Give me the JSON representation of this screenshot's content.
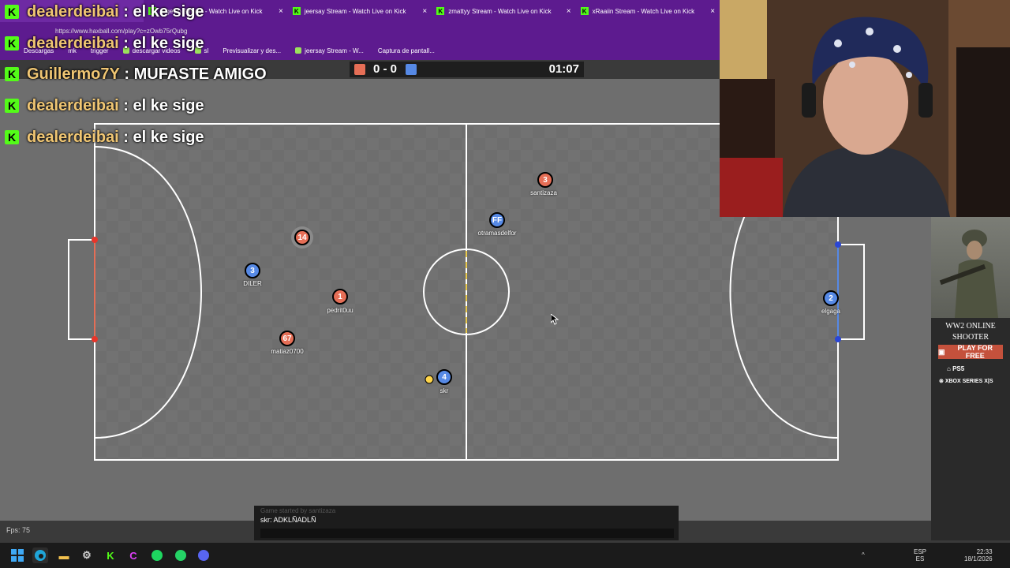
{
  "browser": {
    "tabs": [
      {
        "title": "",
        "active": true
      },
      {
        "title": "rageylo Stream - Watch Live on Kick"
      },
      {
        "title": "jeersay Stream - Watch Live on Kick"
      },
      {
        "title": "zmattyy Stream - Watch Live on Kick"
      },
      {
        "title": "xRaaiin Stream - Watch Live on Kick"
      }
    ],
    "url": "https://www.haxball.com/play?c=zOwb75rQubg",
    "bookmarks": [
      "Descargas",
      "mk",
      "trigger",
      "descargar videos",
      "sl",
      "Previsualizar y des...",
      "jeersay Stream - W...",
      "Captura de pantall..."
    ]
  },
  "chat_overlay": [
    {
      "user": "dealerdeibai",
      "message": "el ke sige"
    },
    {
      "user": "dealerdeibai",
      "message": "el ke sige"
    },
    {
      "user": "Guillermo7Y",
      "message": "MUFASTE AMIGO"
    },
    {
      "user": "dealerdeibai",
      "message": "el ke sige"
    },
    {
      "user": "dealerdeibai",
      "message": "el ke sige"
    }
  ],
  "game": {
    "score": "0 - 0",
    "time": "01:07",
    "colors": {
      "red": "#e56e56",
      "blue": "#5689e5",
      "ball": "#ffd54a"
    },
    "players": [
      {
        "team": "red",
        "number": "3",
        "name": "santizaza"
      },
      {
        "team": "blue",
        "number": "FF",
        "name": "otramasdelfor"
      },
      {
        "team": "red",
        "number": "14",
        "name": ""
      },
      {
        "team": "blue",
        "number": "3",
        "name": "DILER"
      },
      {
        "team": "red",
        "number": "1",
        "name": "pedrit0uu"
      },
      {
        "team": "red",
        "number": "67",
        "name": "matiaz0700"
      },
      {
        "team": "blue",
        "number": "4",
        "name": "skr"
      },
      {
        "team": "blue",
        "number": "2",
        "name": "elgaga"
      }
    ],
    "fps": "Fps: 75",
    "chat": {
      "faded_line": "Game started by santizaza",
      "last_message": "skr: ADKLÑADLÑ",
      "input_value": ""
    }
  },
  "ad": {
    "title_line1": "WW2 ONLINE",
    "title_line2": "SHOOTER",
    "button": "PLAY FOR FREE",
    "platform1": "PS5",
    "platform2": "XBOX SERIES X|S"
  },
  "taskbar": {
    "lang1": "ESP",
    "lang2": "ES",
    "time": "22:33",
    "date": "18/1/2026"
  }
}
